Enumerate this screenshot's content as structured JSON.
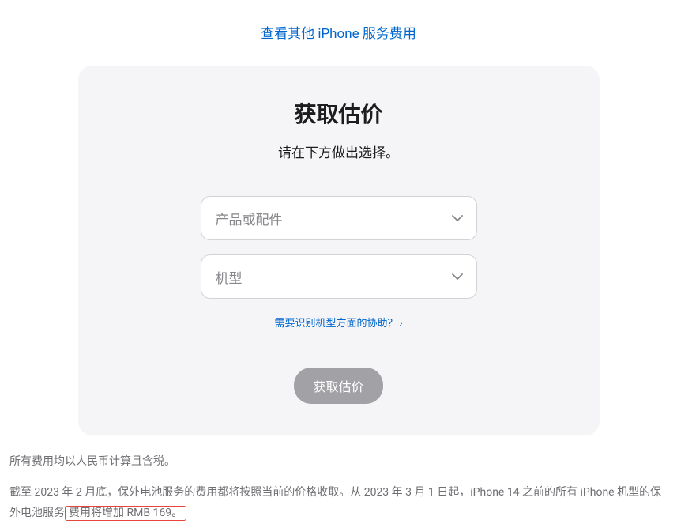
{
  "topLink": {
    "text": "查看其他 iPhone 服务费用"
  },
  "card": {
    "title": "获取估价",
    "subtitle": "请在下方做出选择。",
    "select1": {
      "placeholder": "产品或配件"
    },
    "select2": {
      "placeholder": "机型"
    },
    "helpLink": {
      "text": "需要识别机型方面的协助？"
    },
    "submit": {
      "label": "获取估价"
    }
  },
  "footer": {
    "line1": "所有费用均以人民币计算且含税。",
    "line2_part1": "截至 2023 年 2 月底，保外电池服务的费用都将按照当前的价格收取。从 2023 年 3 月 1 日起，iPhone 14 之前的所有 iPhone 机型的保外电池服务",
    "line2_highlight": "费用将增加 RMB 169。"
  }
}
